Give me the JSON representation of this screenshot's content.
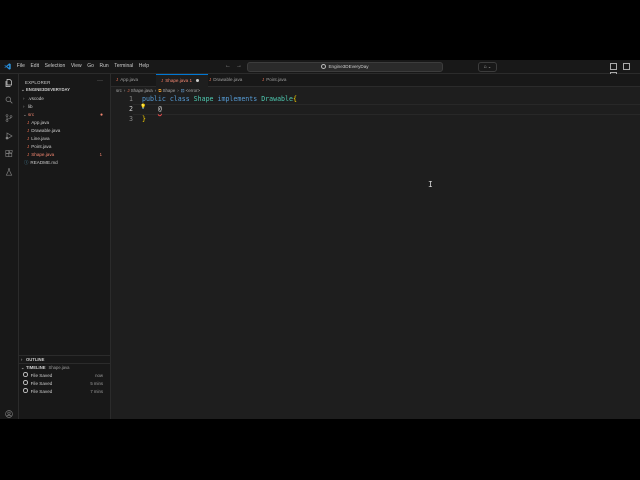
{
  "menu": [
    "File",
    "Edit",
    "Selection",
    "View",
    "Go",
    "Run",
    "Terminal",
    "Help"
  ],
  "search": {
    "text": "Engine3DEveryDay"
  },
  "explorer": {
    "title": "EXPLORER",
    "project": "ENGINE3DEVERYDAY",
    "items": [
      {
        "label": ".vscode",
        "kind": "folder",
        "chev": "›",
        "depth": 1
      },
      {
        "label": "lib",
        "kind": "folder",
        "chev": "›",
        "depth": 1
      },
      {
        "label": "src",
        "kind": "folder-open",
        "chev": "⌄",
        "depth": 1,
        "error": true
      },
      {
        "label": "App.java",
        "kind": "java",
        "depth": 2
      },
      {
        "label": "Drawable.java",
        "kind": "java",
        "depth": 2
      },
      {
        "label": "Line.java",
        "kind": "java",
        "depth": 2
      },
      {
        "label": "Point.java",
        "kind": "java",
        "depth": 2
      },
      {
        "label": "Shape.java",
        "kind": "java",
        "depth": 2,
        "error": true,
        "badge": "1"
      },
      {
        "label": "README.md",
        "kind": "md",
        "depth": 1
      }
    ]
  },
  "outline": {
    "label": "OUTLINE"
  },
  "timeline": {
    "label": "TIMELINE",
    "file": "Shape.java",
    "entries": [
      {
        "label": "File Saved",
        "when": "now"
      },
      {
        "label": "File Saved",
        "when": "5 mins"
      },
      {
        "label": "File Saved",
        "when": "7 mins"
      }
    ]
  },
  "tabs": [
    {
      "label": "App.java",
      "active": false
    },
    {
      "label": "Shape.java 1",
      "active": true,
      "dirty": true
    },
    {
      "label": "Drawable.java",
      "active": false
    },
    {
      "label": "Point.java",
      "active": false
    }
  ],
  "breadcrumb": {
    "p1": "src",
    "p2": "Shape.java",
    "p3": "Shape",
    "p4": "<error>"
  },
  "editor": {
    "lines": [
      "1",
      "2",
      "3"
    ],
    "tokens": {
      "kw1": "public",
      "kw2": "class",
      "ty1": "Shape",
      "kw3": "implements",
      "ty2": "Drawable",
      "br_open": "{",
      "at": "@",
      "br_close": "}"
    }
  },
  "colors": {
    "accent": "#0078d4",
    "error": "#f48771",
    "keyword": "#569cd6",
    "type": "#4ec9b0",
    "bracket": "#ffd700"
  }
}
